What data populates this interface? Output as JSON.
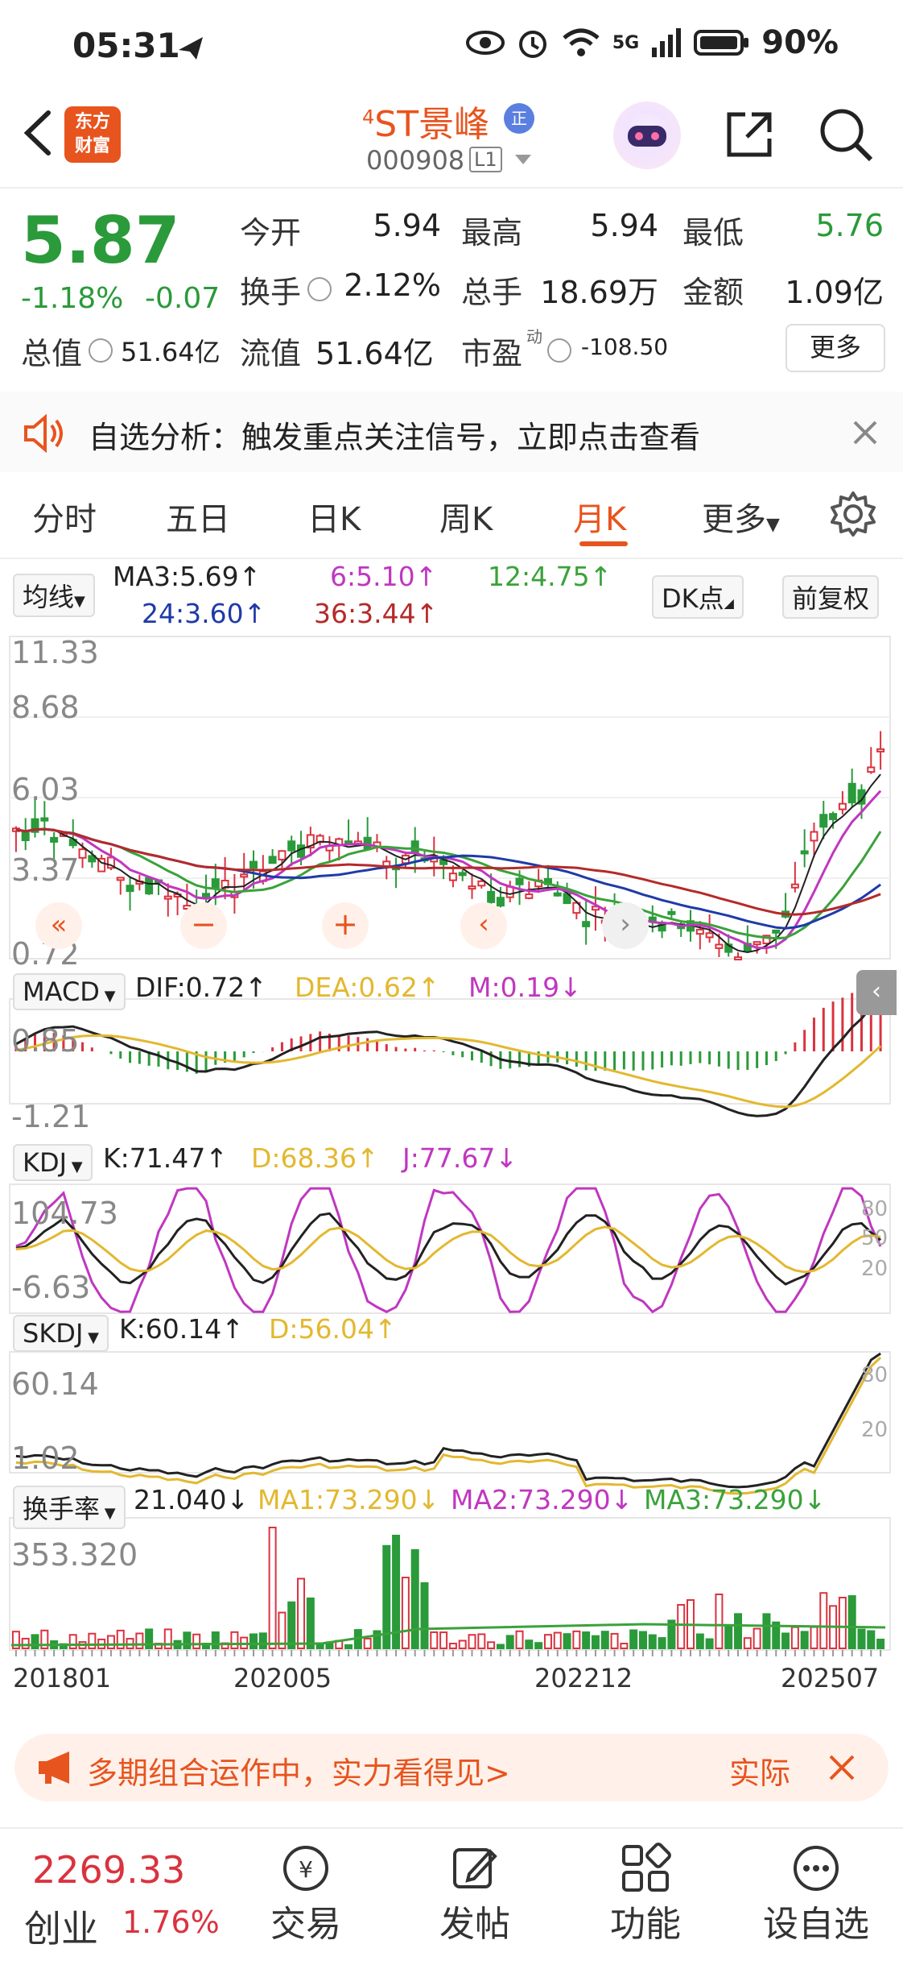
{
  "status_bar": {
    "time": "05:31",
    "network": "5G",
    "battery": "90%"
  },
  "header": {
    "stock_name": "ST景峰",
    "stock_prefix": "4",
    "badge": "正",
    "code": "000908",
    "level": "L1",
    "logo_line1": "东方",
    "logo_line2": "财富"
  },
  "quote": {
    "price": "5.87",
    "change_pct": "-1.18%",
    "change": "-0.07",
    "fields": [
      {
        "label": "今开",
        "value": "5.94"
      },
      {
        "label": "最高",
        "value": "5.94"
      },
      {
        "label": "最低",
        "value": "5.76"
      },
      {
        "label": "换手",
        "value": "2.12%"
      },
      {
        "label": "总手",
        "value": "18.69万"
      },
      {
        "label": "金额",
        "value": "1.09亿"
      },
      {
        "label": "总值",
        "value": "51.64亿"
      },
      {
        "label": "流值",
        "value": "51.64亿"
      },
      {
        "label": "市盈",
        "value": "-108.50"
      }
    ],
    "pe_superscript": "动",
    "more_label": "更多"
  },
  "notice": {
    "text": "自选分析：触发重点关注信号，立即点击查看"
  },
  "tabs": [
    "分时",
    "五日",
    "日K",
    "周K",
    "月K",
    "更多"
  ],
  "active_tab": "月K",
  "ma": {
    "selector": "均线",
    "ma3": "MA3:5.69↑",
    "ma6": "6:5.10↑",
    "ma12": "12:4.75↑",
    "ma24": "24:3.60↑",
    "ma36": "36:3.44↑",
    "dk": "DK点",
    "adjust": "前复权"
  },
  "kline_axis": [
    "11.33",
    "8.68",
    "6.03",
    "3.37",
    "0.72"
  ],
  "macd": {
    "name": "MACD",
    "dif": "DIF:0.72↑",
    "dea": "DEA:0.62↑",
    "m": "M:0.19↓",
    "axis_top": "0.85",
    "axis_bottom": "-1.21"
  },
  "kdj": {
    "name": "KDJ",
    "k": "K:71.47↑",
    "d": "D:68.36↑",
    "j": "J:77.67↓",
    "axis_top": "104.73",
    "axis_bottom": "-6.63",
    "levels": [
      "80",
      "50",
      "20"
    ]
  },
  "skdj": {
    "name": "SKDJ",
    "k": "K:60.14↑",
    "d": "D:56.04↑",
    "axis_top": "60.14",
    "axis_bottom": "1.02",
    "levels": [
      "80",
      "20"
    ]
  },
  "turnover": {
    "name": "换手率",
    "value": "21.040↓",
    "ma1": "MA1:73.290↓",
    "ma2": "MA2:73.290↓",
    "ma3": "MA3:73.290↓",
    "axis_top": "353.320"
  },
  "x_axis": [
    "201801",
    "202005",
    "202212",
    "202507"
  ],
  "ad": {
    "text": "多期组合运作中，实力看得见>",
    "tag": "实际"
  },
  "bottom_nav": {
    "index_value": "2269.33",
    "index_name": "创业",
    "index_pct": "1.76%",
    "items": [
      "交易",
      "发帖",
      "功能",
      "设自选"
    ]
  },
  "colors": {
    "up": "#d9333f",
    "down": "#2a9a3a",
    "accent": "#e8541e",
    "ma3": "#222222",
    "ma6": "#c037c0",
    "ma12": "#3aa23a",
    "ma24": "#1f3aa8",
    "ma36": "#b52a2a"
  }
}
